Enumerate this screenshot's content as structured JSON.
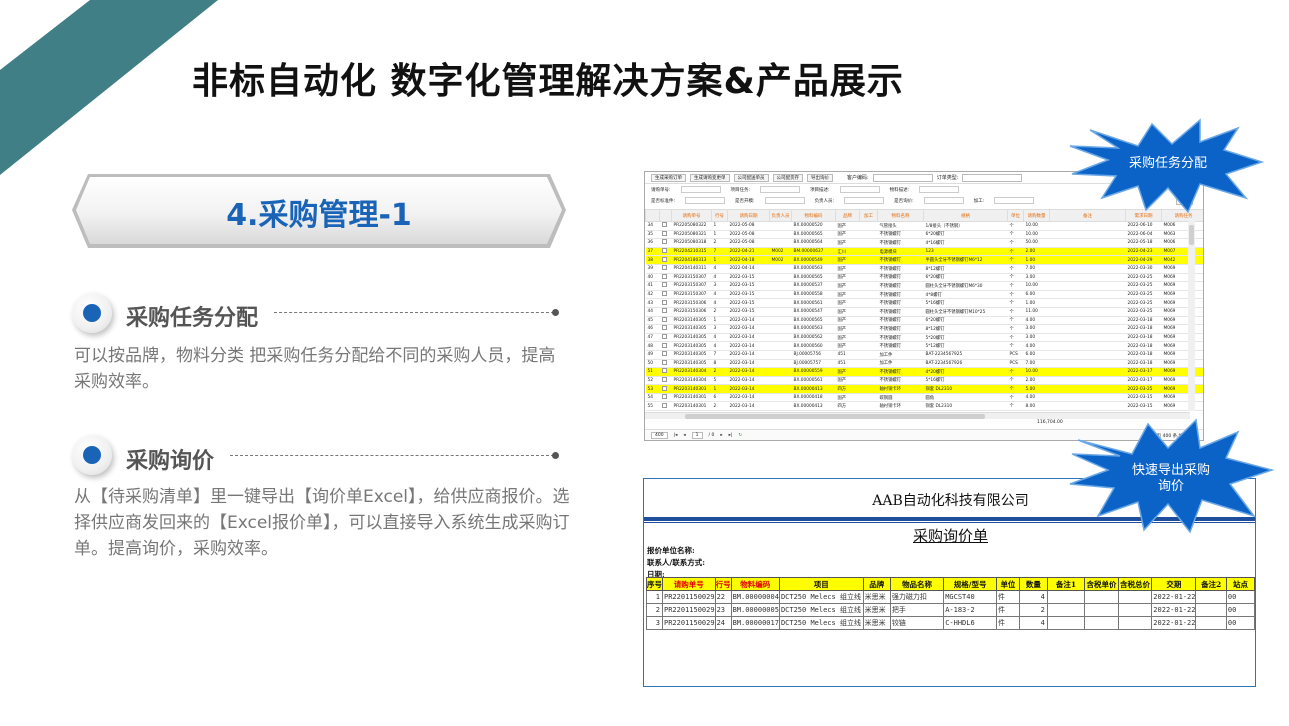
{
  "page": {
    "title": "非标自动化 数字化管理解决方案&产品展示",
    "section_title": "4.采购管理-1"
  },
  "features": [
    {
      "heading": "采购任务分配",
      "description": "可以按品牌，物料分类 把采购任务分配给不同的采购人员，提高采购效率。"
    },
    {
      "heading": "采购询价",
      "description": "从【待采购清单】里一键导出【询价单Excel】，给供应商报价。选择供应商发回来的【Excel报价单】，可以直接导入系统生成采购订单。提高询价，采购效率。"
    }
  ],
  "callouts": {
    "top": "采购任务分配",
    "bottom_line1": "快速导出采购",
    "bottom_line2": "询价"
  },
  "erp": {
    "toolbar": [
      "生成采购订单",
      "生成请购变更单",
      "公司配送单员",
      "公司配货存",
      "导出询价"
    ],
    "toolbar_selects": [
      "客户编码:",
      "订单类型:"
    ],
    "filters_row1": [
      "请购单号:",
      "项目任务:",
      "项目描述:",
      "物料描述:"
    ],
    "filters_row2": [
      "是否标准件:",
      "是否开模:",
      "负责人员:",
      "是否询价:",
      "加工:"
    ],
    "right_button": "查询",
    "columns": [
      "",
      "",
      "请购单号",
      "行号",
      "请购日期",
      "负责人员",
      "物料编码",
      "品牌",
      "加工",
      "物料名称",
      "规格",
      "单位",
      "请购数量",
      "备注",
      "需求日期",
      "请购任务"
    ],
    "rows": [
      [
        "34",
        "PR2205080322",
        "1",
        "2022-05-08",
        "",
        "BX.00000520",
        "国产",
        "",
        "气管接头",
        "1/8接头（不锈钢）",
        "个",
        "10.00",
        "",
        "2022-06-10",
        "M006",
        false
      ],
      [
        "35",
        "PR2205080321",
        "1",
        "2022-05-08",
        "",
        "BX.00000565",
        "国产",
        "",
        "不锈钢螺钉",
        "6*20螺钉",
        "个",
        "10.00",
        "",
        "2022-06-04",
        "M063",
        false
      ],
      [
        "36",
        "PR2205080318",
        "2",
        "2022-05-08",
        "",
        "BX.00000564",
        "国产",
        "",
        "不锈钢螺钉",
        "4*16螺钉",
        "个",
        "50.00",
        "",
        "2022-05-18",
        "M006",
        false
      ],
      [
        "37",
        "PR2204210315",
        "7",
        "2022-04-21",
        "M002",
        "BM.00000637",
        "汇川",
        "",
        "电源模块",
        "123",
        "个",
        "2.00",
        "",
        "2022-04-23",
        "M007",
        true
      ],
      [
        "38",
        "PR2204180313",
        "1",
        "2022-04-18",
        "M002",
        "BX.00000549",
        "国产",
        "",
        "不锈钢螺钉",
        "半圆头全牙不锈钢螺钉M6*12",
        "个",
        "1.00",
        "",
        "2022-04-29",
        "M042",
        true
      ],
      [
        "39",
        "PR2204140311",
        "4",
        "2022-04-14",
        "",
        "BX.00000563",
        "国产",
        "",
        "不锈钢螺钉",
        "8*12螺钉",
        "个",
        "7.00",
        "",
        "2022-03-30",
        "M069",
        false
      ],
      [
        "40",
        "PR2203150307",
        "4",
        "2022-03-15",
        "",
        "BX.00000565",
        "国产",
        "",
        "不锈钢螺钉",
        "6*20螺钉",
        "个",
        "3.00",
        "",
        "2022-03-25",
        "M069",
        false
      ],
      [
        "41",
        "PR2203150307",
        "3",
        "2022-03-15",
        "",
        "BX.00000537",
        "国产",
        "",
        "不锈钢螺钉",
        "圆柱头全牙不锈钢螺钉M6*30",
        "个",
        "10.00",
        "",
        "2022-03-25",
        "M069",
        false
      ],
      [
        "42",
        "PR2203150307",
        "4",
        "2022-03-15",
        "",
        "BX.00000558",
        "国产",
        "",
        "不锈钢螺钉",
        "4*8螺钉",
        "个",
        "6.00",
        "",
        "2022-03-25",
        "M069",
        false
      ],
      [
        "43",
        "PR2203150306",
        "4",
        "2022-03-15",
        "",
        "BX.00000561",
        "国产",
        "",
        "不锈钢螺钉",
        "5*16螺钉",
        "个",
        "1.00",
        "",
        "2022-03-25",
        "M069",
        false
      ],
      [
        "44",
        "PR2203150306",
        "2",
        "2022-03-15",
        "",
        "BX.00000547",
        "国产",
        "",
        "不锈钢螺钉",
        "圆柱头全牙不锈钢螺钉M10*25",
        "个",
        "11.00",
        "",
        "2022-03-25",
        "M069",
        false
      ],
      [
        "45",
        "PR2203140305",
        "1",
        "2022-03-14",
        "",
        "BX.00000565",
        "国产",
        "",
        "不锈钢螺钉",
        "6*20螺钉",
        "个",
        "4.00",
        "",
        "2022-03-18",
        "M069",
        false
      ],
      [
        "46",
        "PR2203140305",
        "3",
        "2022-03-14",
        "",
        "BX.00000563",
        "国产",
        "",
        "不锈钢螺钉",
        "8*12螺钉",
        "个",
        "3.00",
        "",
        "2022-03-18",
        "M069",
        false
      ],
      [
        "47",
        "PR2203140305",
        "4",
        "2022-03-14",
        "",
        "BX.00000562",
        "国产",
        "",
        "不锈钢螺钉",
        "5*20螺钉",
        "个",
        "3.00",
        "",
        "2022-03-18",
        "M069",
        false
      ],
      [
        "48",
        "PR2203140305",
        "4",
        "2022-03-14",
        "",
        "BX.00000560",
        "国产",
        "",
        "不锈钢螺钉",
        "5*12螺钉",
        "个",
        "4.00",
        "",
        "2022-03-18",
        "M069",
        false
      ],
      [
        "49",
        "PR2203140305",
        "7",
        "2022-03-14",
        "",
        "BJ.00005756",
        "451",
        "",
        "加工件",
        "BAT-2234567925",
        "PCS",
        "6.00",
        "",
        "2022-03-18",
        "M069",
        false
      ],
      [
        "50",
        "PR2203140305",
        "8",
        "2022-03-14",
        "",
        "BJ.00005757",
        "451",
        "",
        "加工件",
        "BAT-2234567926",
        "PCS",
        "7.00",
        "",
        "2022-03-18",
        "M069",
        false
      ],
      [
        "51",
        "PR2203140304",
        "2",
        "2022-03-14",
        "",
        "BX.00000559",
        "国产",
        "",
        "不锈钢螺钉",
        "4*20螺钉",
        "个",
        "10.00",
        "",
        "2022-03-17",
        "M069",
        true
      ],
      [
        "52",
        "PR2203140304",
        "5",
        "2022-03-14",
        "",
        "BX.00000561",
        "国产",
        "",
        "不锈钢螺钉",
        "5*16螺钉",
        "个",
        "2.00",
        "",
        "2022-03-17",
        "M069",
        false
      ],
      [
        "53",
        "PR2203140303",
        "1",
        "2022-03-14",
        "",
        "BX.00000413",
        "四方",
        "",
        "轴衬铜卡环",
        "铜套 DL2310",
        "个",
        "5.00",
        "",
        "2022-03-25",
        "M069",
        true
      ],
      [
        "54",
        "PR2203140301",
        "6",
        "2022-03-14",
        "",
        "BX.00000418",
        "国产",
        "",
        "碳钢圆",
        "圆角",
        "个",
        "4.00",
        "",
        "2022-03-15",
        "M069",
        false
      ],
      [
        "55",
        "PR2203140301",
        "2",
        "2022-03-14",
        "",
        "BX.00000413",
        "四方",
        "",
        "轴衬铜卡环",
        "铜套 DL2310",
        "个",
        "8.00",
        "",
        "2022-03-15",
        "M069",
        false
      ]
    ],
    "sum": "116,704.00",
    "pager": {
      "size": "400",
      "page": "1",
      "total_pages": "/ 0",
      "info": "每页 400 条,共 998 条"
    }
  },
  "quotation": {
    "company": "AAB自动化科技有限公司",
    "title": "采购询价单",
    "fields": [
      "报价单位名称:",
      "联系人/联系方式:",
      "日期:"
    ],
    "columns": [
      "序号",
      "请购单号",
      "行号",
      "物料编码",
      "项目",
      "品牌",
      "物品名称",
      "规格/型号",
      "单位",
      "数量",
      "备注1",
      "含税单价",
      "含税总价",
      "交期",
      "备注2",
      "站点"
    ],
    "red_columns": [
      1,
      2,
      3
    ],
    "rows": [
      [
        "1",
        "PR2201150029",
        "22",
        "BM.00000004",
        "DCT250 Melecs 组立线",
        "米思米",
        "强力磁力扣",
        "MGCST40",
        "件",
        "4",
        "",
        "",
        "",
        "2022-01-22",
        "",
        "00"
      ],
      [
        "2",
        "PR2201150029",
        "23",
        "BM.00000005",
        "DCT250 Melecs 组立线",
        "米思米",
        "把手",
        "A-183-2",
        "件",
        "2",
        "",
        "",
        "",
        "2022-01-22",
        "",
        "00"
      ],
      [
        "3",
        "PR2201150029",
        "24",
        "BM.00000017",
        "DCT250 Melecs 组立线",
        "米思米",
        "铰链",
        "C-HHDL6",
        "件",
        "4",
        "",
        "",
        "",
        "2022-01-22",
        "",
        "00"
      ]
    ]
  },
  "colors": {
    "corner": "#3f7f85",
    "accent_blue": "#1a64b8",
    "burst_blue": "#0b63c7",
    "highlight_yellow": "#ffff00"
  }
}
